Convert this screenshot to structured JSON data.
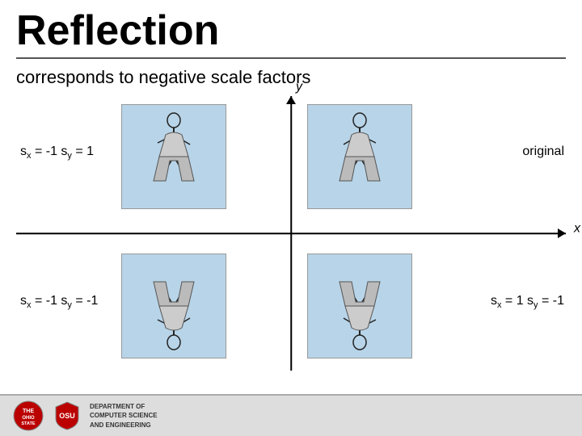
{
  "title": "Reflection",
  "subtitle": "corresponds to negative scale factors",
  "axis_x_label": "x",
  "axis_y_label": "y",
  "label_top_left": "sx = -1 sy = 1",
  "label_top_right": "original",
  "label_bottom_left": "sx = -1 sy = -1",
  "label_bottom_right": "sx = 1 sy = -1",
  "footer": {
    "dept_line1": "DEPARTMENT OF",
    "dept_line2": "COMPUTER SCIENCE",
    "dept_line3": "AND ENGINEERING"
  }
}
